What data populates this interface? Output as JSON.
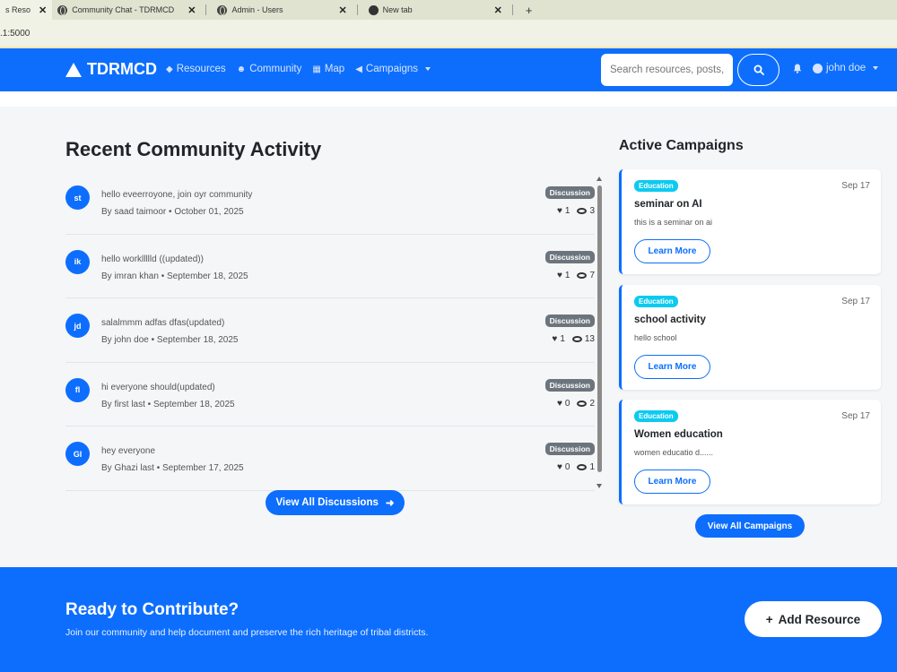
{
  "browser": {
    "tabs": [
      {
        "label": "s Reso",
        "active": true
      },
      {
        "label": "Community Chat - TDRMCD",
        "active": false
      },
      {
        "label": "Admin - Users",
        "active": false
      },
      {
        "label": "New tab",
        "active": false
      }
    ],
    "address": ".1:5000"
  },
  "navbar": {
    "brand": "TDRMCD",
    "links": [
      {
        "label": "Resources",
        "icon": "gem-icon"
      },
      {
        "label": "Community",
        "icon": "users-icon"
      },
      {
        "label": "Map",
        "icon": "map-icon"
      },
      {
        "label": "Campaigns",
        "icon": "bullhorn-icon"
      }
    ],
    "search_placeholder": "Search resources, posts,",
    "user": "john doe"
  },
  "activity": {
    "title": "Recent Community Activity",
    "items": [
      {
        "initials": "st",
        "title": "hello eveerroyone, join oyr community",
        "meta": "By saad taimoor • October 01, 2025",
        "badge": "Discussion",
        "likes": "1",
        "views": "3"
      },
      {
        "initials": "ik",
        "title": "hello workllllld ((updated))",
        "meta": "By imran khan • September 18, 2025",
        "badge": "Discussion",
        "likes": "1",
        "views": "7"
      },
      {
        "initials": "jd",
        "title": "salalmmm adfas dfas(updated)",
        "meta": "By john doe • September 18, 2025",
        "badge": "Discussion",
        "likes": "1",
        "views": "13"
      },
      {
        "initials": "fl",
        "title": "hi everyone should(updated)",
        "meta": "By first last • September 18, 2025",
        "badge": "Discussion",
        "likes": "0",
        "views": "2"
      },
      {
        "initials": "Gl",
        "title": "hey everyone",
        "meta": "By Ghazi last • September 17, 2025",
        "badge": "Discussion",
        "likes": "0",
        "views": "1"
      }
    ],
    "view_all": "View All Discussions"
  },
  "campaigns": {
    "title": "Active Campaigns",
    "items": [
      {
        "badge": "Education",
        "date": "Sep 17",
        "title": "seminar on AI",
        "desc": "this is a seminar on ai",
        "button": "Learn More"
      },
      {
        "badge": "Education",
        "date": "Sep 17",
        "title": "school activity",
        "desc": "hello school",
        "button": "Learn More"
      },
      {
        "badge": "Education",
        "date": "Sep 17",
        "title": "Women education",
        "desc": "women educatio d......",
        "button": "Learn More"
      }
    ],
    "view_all": "View All Campaigns"
  },
  "cta": {
    "title": "Ready to Contribute?",
    "text": "Join our community and help document and preserve the rich heritage of tribal districts.",
    "button": "Add Resource"
  },
  "colors": {
    "primary": "#0d6efd",
    "info": "#0dcaf0",
    "secondary": "#6c757d"
  }
}
